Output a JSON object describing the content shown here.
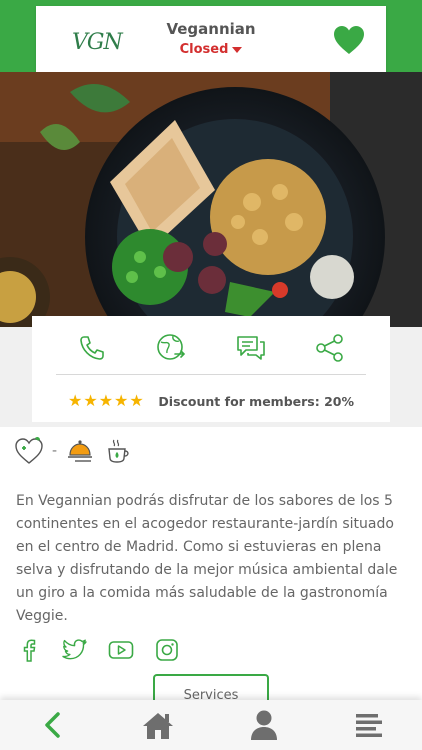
{
  "header": {
    "logo_text": "VGN",
    "restaurant_name": "Vegannian",
    "status": "Closed",
    "favorite_icon": "heart-icon"
  },
  "colors": {
    "brand_green": "#3aa945",
    "status_red": "#d32f2f",
    "star_gold": "#f6b400"
  },
  "hero": {
    "image": "bowl-of-chickpeas-peas-and-figs-photo"
  },
  "actions": [
    {
      "name": "call",
      "icon": "phone-icon"
    },
    {
      "name": "directions",
      "icon": "globe-arrow-icon"
    },
    {
      "name": "reviews",
      "icon": "chat-bubbles-icon"
    },
    {
      "name": "share",
      "icon": "share-icon"
    }
  ],
  "rating": {
    "stars": 5,
    "max": 5
  },
  "discount": "Discount for members: 20%",
  "tags": {
    "separator": "-",
    "icons": [
      "vegan-heart-icon",
      "food-platter-icon",
      "hot-drink-icon"
    ]
  },
  "description": "En Vegannian podrás disfrutar de los sabores de los 5 continentes en el acogedor restaurante-jardín situado en el centro de Madrid. Como si estuvieras en plena selva y disfrutando de la mejor música ambiental dale un giro a la comida más saludable de la gastronomía Veggie.",
  "social": [
    "facebook-icon",
    "twitter-icon",
    "youtube-icon",
    "instagram-icon"
  ],
  "services_label": "Services",
  "bottom_nav": [
    "back-arrow-icon",
    "home-icon",
    "user-icon",
    "menu-icon"
  ]
}
